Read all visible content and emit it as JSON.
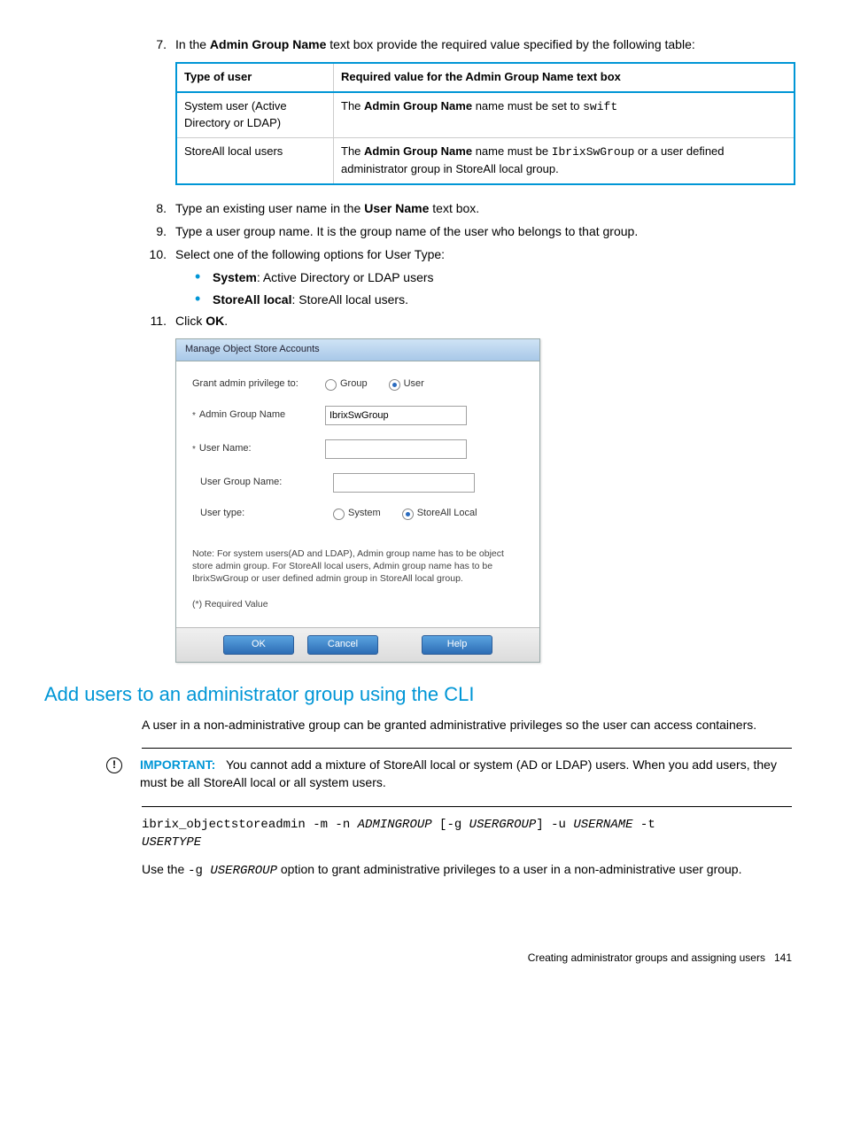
{
  "steps": {
    "s7": {
      "num": "7.",
      "pre": "In the ",
      "b": "Admin Group Name",
      "post": " text box provide the required value specified by the following table:"
    },
    "s8": {
      "num": "8.",
      "pre": "Type an existing user name in the ",
      "b": "User Name",
      "post": " text box."
    },
    "s9": {
      "num": "9.",
      "text": "Type a user group name. It is the group name of the user who belongs to that group."
    },
    "s10": {
      "num": "10.",
      "text": "Select one of the following options for User Type:"
    },
    "s10a": {
      "b": "System",
      "post": ": Active Directory or LDAP users"
    },
    "s10b": {
      "b": "StoreAll local",
      "post": ": StoreAll local users."
    },
    "s11": {
      "num": "11.",
      "pre": "Click ",
      "b": "OK",
      "post": "."
    }
  },
  "table": {
    "h1": "Type of user",
    "h2": "Required value for the Admin Group Name text box",
    "r1c1": "System user (Active Directory or LDAP)",
    "r1c2_pre": "The ",
    "r1c2_b": "Admin Group Name",
    "r1c2_mid": " name must be set to ",
    "r1c2_code": "swift",
    "r2c1": "StoreAll local users",
    "r2c2_pre": "The ",
    "r2c2_b": "Admin Group Name",
    "r2c2_mid": " name must be ",
    "r2c2_code": "IbrixSwGroup",
    "r2c2_post": " or a user defined administrator group in StoreAll local group."
  },
  "dialog": {
    "title": "Manage Object Store Accounts",
    "grant": "Grant admin privilege to:",
    "group": "Group",
    "user": "User",
    "admin_label": "Admin Group Name",
    "admin_value": "IbrixSwGroup",
    "uname_label": "User Name:",
    "ugroup_label": "User Group Name:",
    "utype_label": "User type:",
    "system": "System",
    "storeall": "StoreAll Local",
    "note": "Note: For system users(AD and LDAP), Admin group name has to be object store admin group. For StoreAll local users, Admin group name has to be IbrixSwGroup or user defined admin group in StoreAll local group.",
    "req": "(*) Required Value",
    "ok": "OK",
    "cancel": "Cancel",
    "help": "Help"
  },
  "section_title": "Add users to an administrator group using the CLI",
  "section_para": "A user in a non-administrative group can be granted administrative privileges so the user can access containers.",
  "important": {
    "label": "IMPORTANT:",
    "text": "You cannot add a mixture of StoreAll local or system (AD or LDAP) users. When you add users, they must be all StoreAll local or all system users."
  },
  "cmd": {
    "p1": "ibrix_objectstoreadmin -m -n ",
    "a1": "ADMINGROUP",
    "p2": " [-g ",
    "a2": "USERGROUP",
    "p3": "] -u ",
    "a3": "USERNAME",
    "p4": " -t ",
    "a4": "USERTYPE"
  },
  "usage": {
    "pre": "Use the ",
    "flag": "-g ",
    "arg": "USERGROUP",
    "post": " option to grant administrative privileges to a user in a non-administrative user group."
  },
  "footer": {
    "text": "Creating administrator groups and assigning users",
    "page": "141"
  }
}
